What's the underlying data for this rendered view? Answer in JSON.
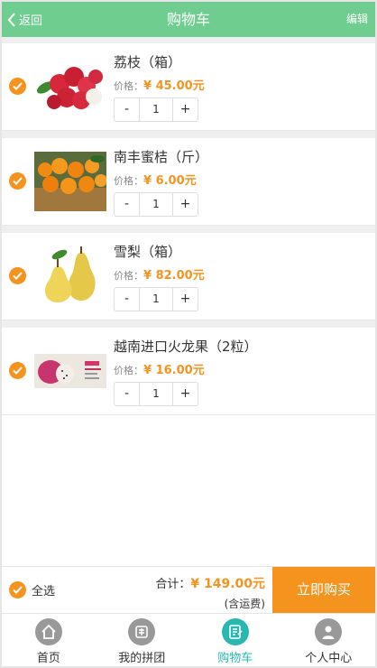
{
  "header": {
    "back_label": "返回",
    "title": "购物车",
    "edit_label": "编辑"
  },
  "items": [
    {
      "name": "荔枝（箱）",
      "price_label": "价格：",
      "price": "¥ 45.00元",
      "qty": "1",
      "minus": "-",
      "plus": "+"
    },
    {
      "name": "南丰蜜桔（斤）",
      "price_label": "价格：",
      "price": "¥ 6.00元",
      "qty": "1",
      "minus": "-",
      "plus": "+"
    },
    {
      "name": "雪梨（箱）",
      "price_label": "价格：",
      "price": "¥ 82.00元",
      "qty": "1",
      "minus": "-",
      "plus": "+"
    },
    {
      "name": "越南进口火龙果（2粒）",
      "price_label": "价格：",
      "price": "¥ 16.00元",
      "qty": "1",
      "minus": "-",
      "plus": "+"
    }
  ],
  "footer": {
    "select_all_label": "全选",
    "total_label": "合计：",
    "total_amount": "¥ 149.00元",
    "shipping_note": "(含运费)",
    "buy_label": "立即购买"
  },
  "tabbar": {
    "tabs": [
      {
        "label": "首页",
        "icon": "home-icon"
      },
      {
        "label": "我的拼团",
        "icon": "group-icon"
      },
      {
        "label": "购物车",
        "icon": "cart-icon",
        "active": true
      },
      {
        "label": "个人中心",
        "icon": "user-icon"
      }
    ]
  },
  "colors": {
    "header_green": "#6fce8f",
    "accent_orange": "#f4941f",
    "active_teal": "#28b8b0",
    "inactive_icon": "#999999"
  }
}
